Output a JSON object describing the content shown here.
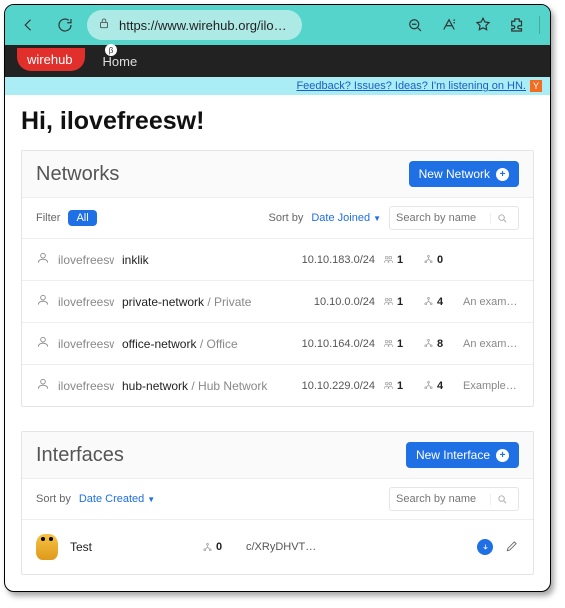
{
  "browser": {
    "url": "https://www.wirehub.org/ilov…"
  },
  "brand": {
    "a": "wire",
    "b": "hub",
    "beta": "β"
  },
  "nav": {
    "home": "Home"
  },
  "banner": {
    "text": "Feedback? Issues? Ideas? I'm listening on HN.",
    "badge": "Y"
  },
  "greeting": "Hi, ilovefreesw!",
  "networks": {
    "title": "Networks",
    "new": "New Network",
    "filter_label": "Filter",
    "filter_all": "All",
    "sort_label": "Sort by",
    "sort_value": "Date Joined",
    "search_ph": "Search by name",
    "rows": [
      {
        "owner": "ilovefreesw",
        "name": "inklik",
        "label": "",
        "cidr": "10.10.183.0/24",
        "peers": "1",
        "links": "0",
        "desc": ""
      },
      {
        "owner": "ilovefreesw",
        "name": "private-network",
        "label": " / Private",
        "cidr": "10.10.0.0/24",
        "peers": "1",
        "links": "4",
        "desc": "An example private network"
      },
      {
        "owner": "ilovefreesw",
        "name": "office-network",
        "label": " / Office",
        "cidr": "10.10.164.0/24",
        "peers": "1",
        "links": "8",
        "desc": "An example of an office network"
      },
      {
        "owner": "ilovefreesw",
        "name": "hub-network",
        "label": " / Hub Network",
        "cidr": "10.10.229.0/24",
        "peers": "1",
        "links": "4",
        "desc": "Example of a Hub Network"
      }
    ]
  },
  "interfaces": {
    "title": "Interfaces",
    "new": "New Interface",
    "sort_label": "Sort by",
    "sort_value": "Date Created",
    "search_ph": "Search by name",
    "rows": [
      {
        "name": "Test",
        "links": "0",
        "key": "c/XRyDHVT…"
      }
    ]
  }
}
